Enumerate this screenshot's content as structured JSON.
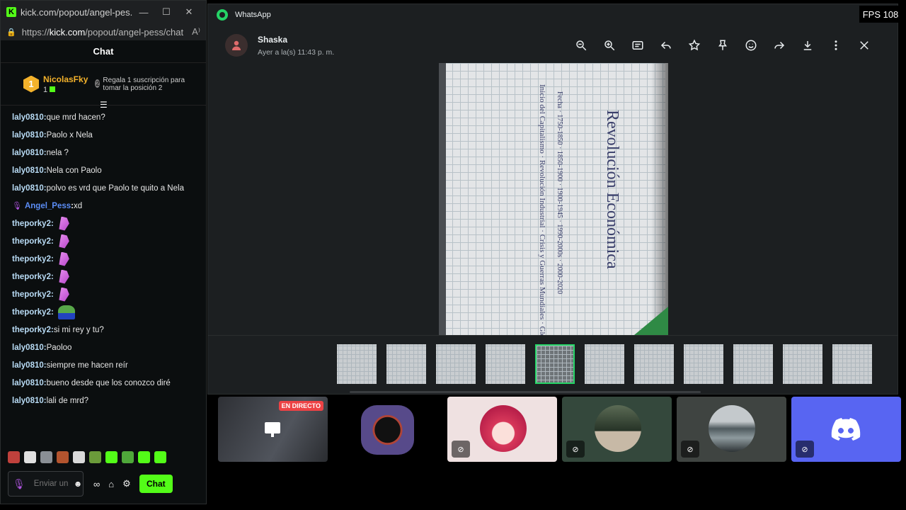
{
  "kick": {
    "tab_title": "kick.com/popout/angel-pes...",
    "url_prefix": "https://",
    "url_host": "kick.com",
    "url_path": "/popout/angel-pess/chat",
    "reader_icon": "A⁾",
    "chat_title": "Chat",
    "pinned": {
      "rank": "1",
      "username": "NicolasFky",
      "count": "1",
      "gift_badge": "2",
      "gift_text": "Regala 1 suscripción para tomar la posición 2"
    },
    "messages": [
      {
        "user": "laly0810",
        "text": "que mrd hacen?"
      },
      {
        "user": "laly0810",
        "text": "Paolo x Nela"
      },
      {
        "user": "laly0810",
        "text": "nela ?"
      },
      {
        "user": "laly0810",
        "text": "Nela con Paolo"
      },
      {
        "user": "laly0810",
        "text": "polvo es vrd que Paolo te quito a Nela"
      },
      {
        "user": "Angel_Pess",
        "text": "xd",
        "host": true
      },
      {
        "user": "theporky2",
        "emote": "pink"
      },
      {
        "user": "theporky2",
        "emote": "pink"
      },
      {
        "user": "theporky2",
        "emote": "pink"
      },
      {
        "user": "theporky2",
        "emote": "pink"
      },
      {
        "user": "theporky2",
        "emote": "pink"
      },
      {
        "user": "theporky2",
        "emote": "frog"
      },
      {
        "user": "theporky2",
        "text": "si mi rey y tu?"
      },
      {
        "user": "laly0810",
        "text": "Paoloo"
      },
      {
        "user": "laly0810",
        "text": "siempre me hacen reír"
      },
      {
        "user": "laly0810",
        "text": "bueno desde que los conozco diré"
      },
      {
        "user": "laly0810",
        "text": "lali de mrd?"
      }
    ],
    "input_placeholder": "Enviar un mensaje",
    "chat_button": "Chat",
    "emote_colors": [
      "#c0413c",
      "#e0e0e0",
      "#8a8f95",
      "#b3542e",
      "#d9d9d9",
      "#6b9b3a",
      "#53fc18",
      "#4fa83a",
      "#53fc18",
      "#53fc18"
    ]
  },
  "whatsapp": {
    "app_title": "WhatsApp",
    "contact": "Shaska",
    "timestamp": "Ayer a la(s) 11:43 p. m.",
    "photo_texts": {
      "title": "Revolución Económica",
      "col1": "Inicio del Capitalismo · Revolución Industrial · Crisis y Guerras Mundiales · Globalización · Economía Digital",
      "col2": "Fecha · 1750-1850 · 1850-1900 · 1900-1945 · 1990-2000s · 2000-2020"
    },
    "thumb_count": 11,
    "selected_thumb": 4
  },
  "fps": "FPS 108",
  "discord": {
    "live_label": "EN DIRECTO"
  }
}
